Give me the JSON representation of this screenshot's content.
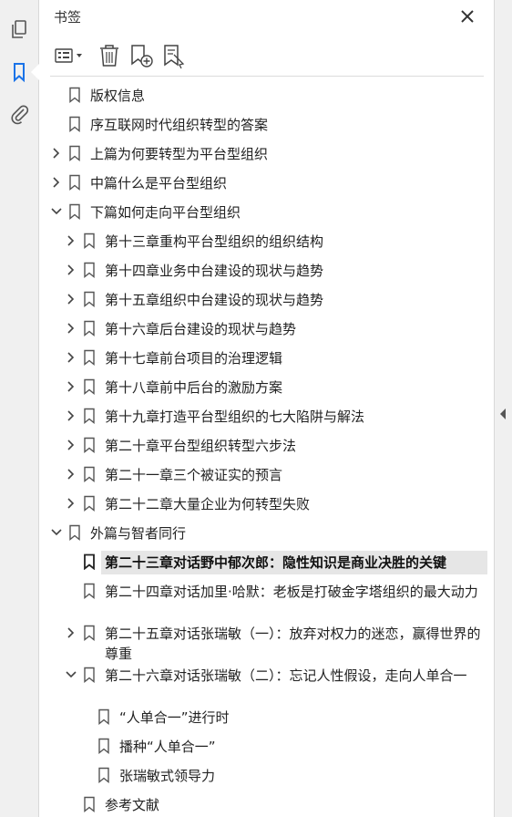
{
  "panel": {
    "title": "书签"
  },
  "icons": {
    "left": [
      "pages-icon",
      "bookmark-icon",
      "attachment-icon"
    ],
    "toolbar": [
      "options-menu-icon",
      "delete-icon",
      "new-bookmark-icon",
      "bookmark-from-structure-icon"
    ],
    "close": "close-icon"
  },
  "colors": {
    "accent": "#1a73e8",
    "selected_bg": "#e6e6e6"
  },
  "bookmarks": [
    {
      "label": "版权信息",
      "level": 0,
      "expander": "none",
      "selected": false
    },
    {
      "label": "序互联网时代组织转型的答案",
      "level": 0,
      "expander": "none",
      "selected": false
    },
    {
      "label": "上篇为何要转型为平台型组织",
      "level": 0,
      "expander": "collapsed",
      "selected": false
    },
    {
      "label": "中篇什么是平台型组织",
      "level": 0,
      "expander": "collapsed",
      "selected": false
    },
    {
      "label": "下篇如何走向平台型组织",
      "level": 0,
      "expander": "expanded",
      "selected": false
    },
    {
      "label": "第十三章重构平台型组织的组织结构",
      "level": 1,
      "expander": "collapsed",
      "selected": false
    },
    {
      "label": "第十四章业务中台建设的现状与趋势",
      "level": 1,
      "expander": "collapsed",
      "selected": false
    },
    {
      "label": "第十五章组织中台建设的现状与趋势",
      "level": 1,
      "expander": "collapsed",
      "selected": false
    },
    {
      "label": "第十六章后台建设的现状与趋势",
      "level": 1,
      "expander": "collapsed",
      "selected": false
    },
    {
      "label": "第十七章前台项目的治理逻辑",
      "level": 1,
      "expander": "collapsed",
      "selected": false
    },
    {
      "label": "第十八章前中后台的激励方案",
      "level": 1,
      "expander": "collapsed",
      "selected": false
    },
    {
      "label": "第十九章打造平台型组织的七大陷阱与解法",
      "level": 1,
      "expander": "collapsed",
      "selected": false
    },
    {
      "label": "第二十章平台型组织转型六步法",
      "level": 1,
      "expander": "collapsed",
      "selected": false
    },
    {
      "label": "第二十一章三个被证实的预言",
      "level": 1,
      "expander": "collapsed",
      "selected": false
    },
    {
      "label": "第二十二章大量企业为何转型失败",
      "level": 1,
      "expander": "collapsed",
      "selected": false
    },
    {
      "label": "外篇与智者同行",
      "level": 0,
      "expander": "expanded",
      "selected": false
    },
    {
      "label": "第二十三章对话野中郁次郎：隐性知识是商业决胜的关键",
      "level": 1,
      "expander": "none",
      "selected": true
    },
    {
      "label": "第二十四章对话加里·哈默：老板是打破金字塔组织的最大动力",
      "level": 1,
      "expander": "none",
      "selected": false
    },
    {
      "label": "第二十五章对话张瑞敏（一）：放弃对权力的迷恋，赢得世界的尊重",
      "level": 1,
      "expander": "collapsed",
      "selected": false
    },
    {
      "label": "第二十六章对话张瑞敏（二）：忘记人性假设，走向人单合一",
      "level": 1,
      "expander": "expanded",
      "selected": false
    },
    {
      "label": "“人单合一”进行时",
      "level": 2,
      "expander": "none",
      "selected": false
    },
    {
      "label": "播种“人单合一”",
      "level": 2,
      "expander": "none",
      "selected": false
    },
    {
      "label": "张瑞敏式领导力",
      "level": 2,
      "expander": "none",
      "selected": false
    },
    {
      "label": "参考文献",
      "level": 1,
      "expander": "none",
      "selected": false
    }
  ]
}
